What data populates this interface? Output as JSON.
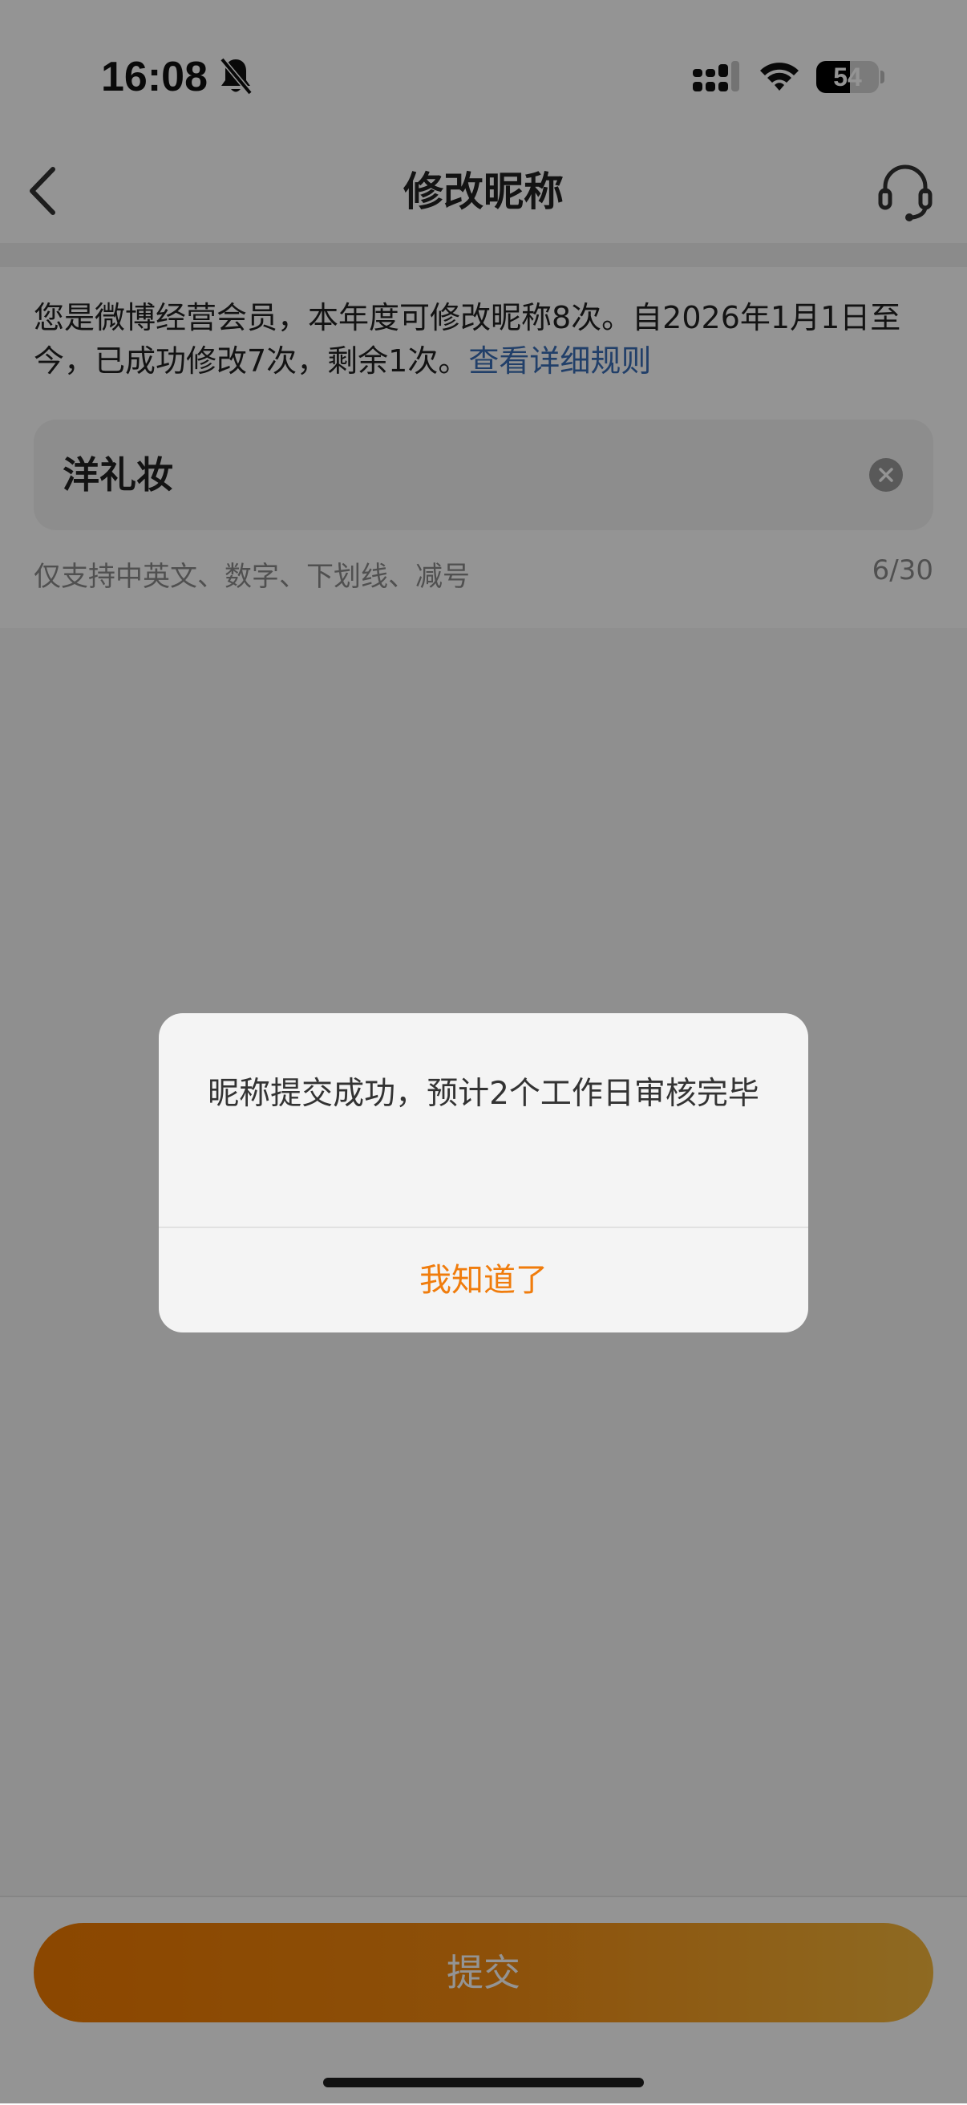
{
  "status_bar": {
    "time": "16:08",
    "battery_level": "54",
    "battery_fraction": 0.54,
    "icons": [
      "bell-slash-icon",
      "cellular-signal-icon",
      "wifi-icon",
      "battery-icon"
    ]
  },
  "nav": {
    "title": "修改昵称",
    "back_icon": "chevron-left-icon",
    "service_icon": "headset-icon"
  },
  "info": {
    "text": "您是微博经营会员，本年度可修改昵称8次。自2026年1月1日至今，已成功修改7次，剩余1次。",
    "link": "查看详细规则"
  },
  "nickname_input": {
    "value": "洋礼妆",
    "clear_icon": "clear-circle-icon"
  },
  "hint": {
    "text": "仅支持中英文、数字、下划线、减号",
    "counter": "6/30"
  },
  "submit": {
    "label": "提交"
  },
  "dialog": {
    "message": "昵称提交成功，预计2个工作日审核完毕",
    "button_label": "我知道了"
  },
  "colors": {
    "accent": "#f07c0c",
    "link": "#3a6db5",
    "gradient_start": "#f07a00",
    "gradient_end": "#f5b73b"
  }
}
